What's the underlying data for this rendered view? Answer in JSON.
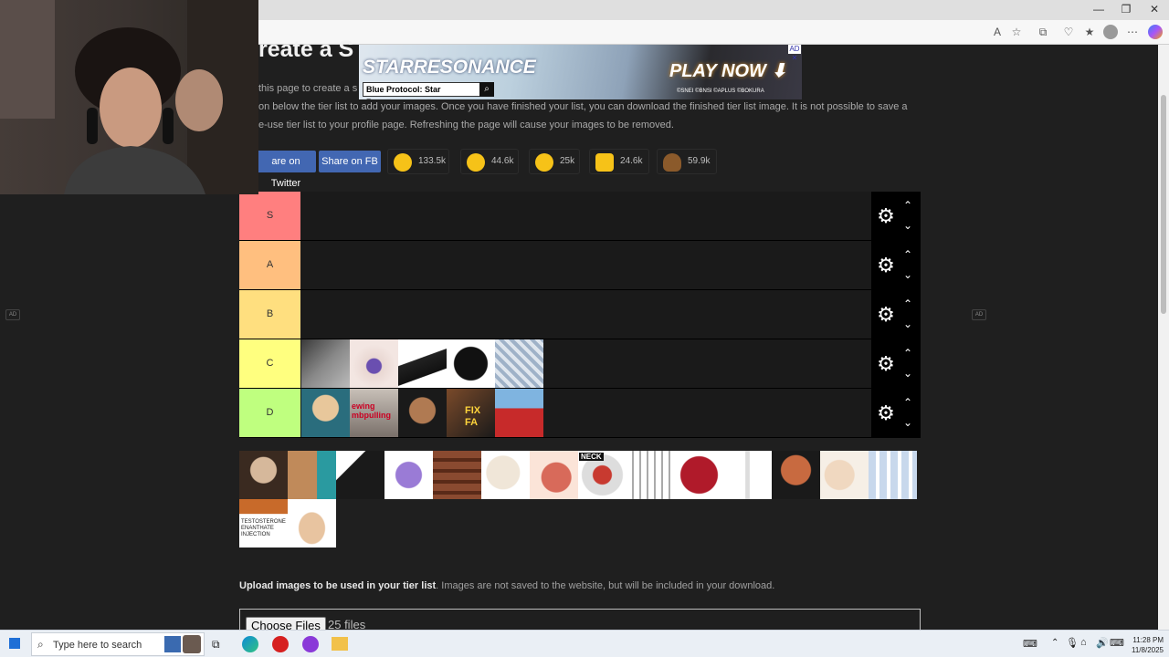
{
  "window": {
    "minimize": "—",
    "restore": "❐",
    "close": "✕"
  },
  "page": {
    "title": "reate a S",
    "description_lines": [
      "this page to create a s                                                                                                                     website. Use the Upload",
      "on below the tier list to add your images. Once you have finished your list, you can download the finished tier list image. It is not possible to save a",
      "e-use tier list to your profile page. Refreshing the page will cause your images to be removed."
    ]
  },
  "ad": {
    "logo": "STARRESONANCE",
    "search_label": "Blue Protocol: Star Resonance",
    "play_label": "PLAY NOW ⬇",
    "copyright": "©SNEI ©BNSI ©APLUS ©BOKURA",
    "ad_close": "AD ✕",
    "side_tag": "AD"
  },
  "share": {
    "twitter": "are on Twitter",
    "fb": "Share on FB"
  },
  "reactions": [
    {
      "icon": "grin-emoji-icon",
      "count": "133.5k",
      "color": "#f6c218"
    },
    {
      "icon": "heart-eyes-emoji-icon",
      "count": "44.6k",
      "color": "#f6c218"
    },
    {
      "icon": "laughing-emoji-icon",
      "count": "25k",
      "color": "#f6c218"
    },
    {
      "icon": "raised-hands-emoji-icon",
      "count": "24.6k",
      "color": "#f6c218"
    },
    {
      "icon": "poop-emoji-icon",
      "count": "59.9k",
      "color": "#8b5a2b"
    }
  ],
  "tiers": [
    {
      "label": "S",
      "color": "#ff7f7f"
    },
    {
      "label": "A",
      "color": "#ffbf7f"
    },
    {
      "label": "B",
      "color": "#ffdf7f"
    },
    {
      "label": "C",
      "color": "#ffff7f"
    },
    {
      "label": "D",
      "color": "#bfff7f"
    }
  ],
  "tier_controls": {
    "gear": "⚙",
    "up": "⌃",
    "down": "⌄"
  },
  "pool_label_text": {
    "neck": "NECK",
    "testosterone": "TESTOSTERONE ENANTHATE INJECTION",
    "fix": "FIX FA",
    "chewing": "ewing mbpulling"
  },
  "upload": {
    "bold": "Upload images to be used in your tier list",
    "rest": ". Images are not saved to the website, but will be included in your download.",
    "choose": "Choose Files",
    "files": "25 files"
  },
  "taskbar": {
    "search_placeholder": "Type here to search",
    "time": "11:28 PM",
    "date": "11/8/2025"
  }
}
